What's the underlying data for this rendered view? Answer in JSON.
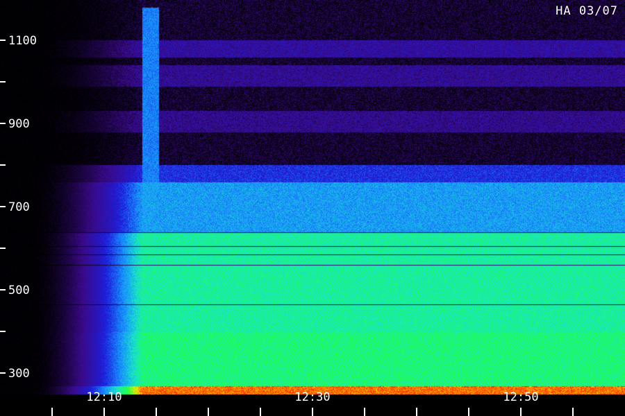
{
  "station_label": "HA 03/07",
  "chart_data": {
    "type": "heatmap",
    "title": "",
    "xlabel": "",
    "ylabel": "",
    "ylim": [
      250,
      1200
    ],
    "y_ticks": [
      {
        "value": 1100,
        "label": "1100"
      },
      {
        "value": 1000,
        "label": ""
      },
      {
        "value": 900,
        "label": "900"
      },
      {
        "value": 800,
        "label": ""
      },
      {
        "value": 700,
        "label": "700"
      },
      {
        "value": 600,
        "label": ""
      },
      {
        "value": 500,
        "label": "500"
      },
      {
        "value": 400,
        "label": ""
      },
      {
        "value": 300,
        "label": "300"
      }
    ],
    "x_ticks": [
      {
        "label": ""
      },
      {
        "label": ""
      },
      {
        "label": "12:10"
      },
      {
        "label": ""
      },
      {
        "label": ""
      },
      {
        "label": ""
      },
      {
        "label": "12:30"
      },
      {
        "label": ""
      },
      {
        "label": ""
      },
      {
        "label": ""
      },
      {
        "label": "12:50"
      },
      {
        "label": ""
      }
    ],
    "x_tick_label_values": [
      "12:10",
      "12:30",
      "12:50"
    ],
    "colormap": [
      "#000000",
      "#3a0a8a",
      "#1e1edc",
      "#1890ff",
      "#19e6c8",
      "#1eff4a",
      "#f0f000",
      "#ff2a00"
    ],
    "bands": [
      {
        "from": 1060,
        "to": 1100,
        "intensity": 0.18
      },
      {
        "from": 990,
        "to": 1040,
        "intensity": 0.16
      },
      {
        "from": 880,
        "to": 930,
        "intensity": 0.15
      },
      {
        "from": 760,
        "to": 800,
        "intensity": 0.3
      },
      {
        "from": 640,
        "to": 760,
        "intensity": 0.45
      },
      {
        "from": 400,
        "to": 640,
        "intensity": 0.62
      },
      {
        "from": 270,
        "to": 400,
        "intensity": 0.66
      },
      {
        "from": 250,
        "to": 270,
        "intensity": 0.95
      }
    ],
    "dark_lines_mhz": [
      638,
      605,
      585,
      560,
      465
    ]
  }
}
